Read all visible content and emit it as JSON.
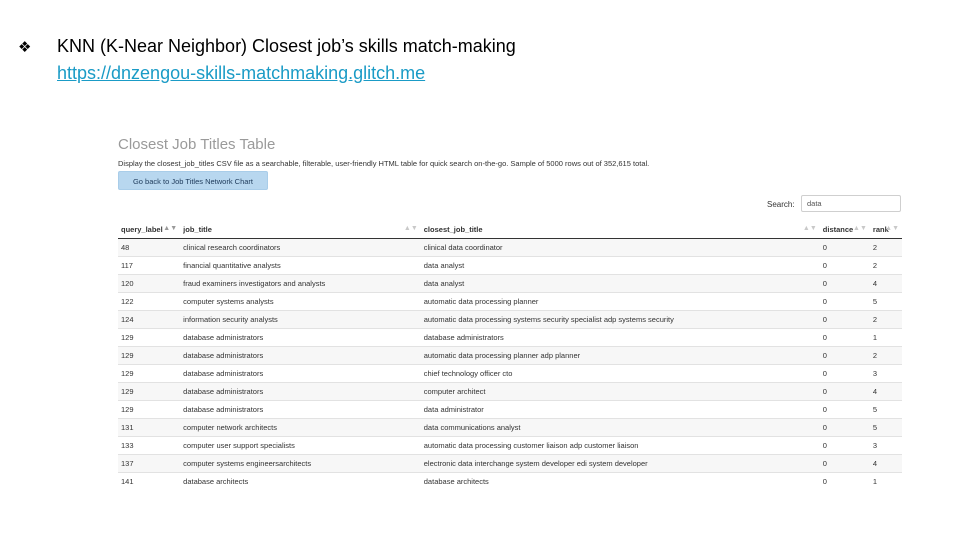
{
  "slide": {
    "bullet_icon": "diamond-bullet-icon",
    "bullet_glyph": "❖",
    "title": "KNN (K-Near Neighbor) Closest job’s skills match-making",
    "link": "https://dnzengou-skills-matchmaking.glitch.me"
  },
  "page": {
    "heading": "Closest Job Titles Table",
    "description": "Display the closest_job_titles CSV file as a searchable, filterable, user-friendly HTML table for quick search on-the-go. Sample of 5000 rows out of 352,615 total.",
    "back_button": "Go back to Job Titles Network Chart",
    "search_label": "Search:",
    "search_value": "data"
  },
  "table": {
    "columns": [
      "query_label",
      "job_title",
      "closest_job_title",
      "distance",
      "rank"
    ],
    "sort_icon": "sort-arrows-icon",
    "rows": [
      [
        "48",
        "clinical research coordinators",
        "clinical data coordinator",
        "0",
        "2"
      ],
      [
        "117",
        "financial quantitative analysts",
        "data analyst",
        "0",
        "2"
      ],
      [
        "120",
        "fraud examiners investigators and analysts",
        "data analyst",
        "0",
        "4"
      ],
      [
        "122",
        "computer systems analysts",
        "automatic data processing planner",
        "0",
        "5"
      ],
      [
        "124",
        "information security analysts",
        "automatic data processing systems security specialist adp systems security",
        "0",
        "2"
      ],
      [
        "129",
        "database administrators",
        "database administrators",
        "0",
        "1"
      ],
      [
        "129",
        "database administrators",
        "automatic data processing planner adp planner",
        "0",
        "2"
      ],
      [
        "129",
        "database administrators",
        "chief technology officer cto",
        "0",
        "3"
      ],
      [
        "129",
        "database administrators",
        "computer architect",
        "0",
        "4"
      ],
      [
        "129",
        "database administrators",
        "data administrator",
        "0",
        "5"
      ],
      [
        "131",
        "computer network architects",
        "data communications analyst",
        "0",
        "5"
      ],
      [
        "133",
        "computer user support specialists",
        "automatic data processing customer liaison adp customer liaison",
        "0",
        "3"
      ],
      [
        "137",
        "computer systems engineersarchitects",
        "electronic data interchange system developer edi system developer",
        "0",
        "4"
      ],
      [
        "141",
        "database architects",
        "database architects",
        "0",
        "1"
      ]
    ]
  }
}
